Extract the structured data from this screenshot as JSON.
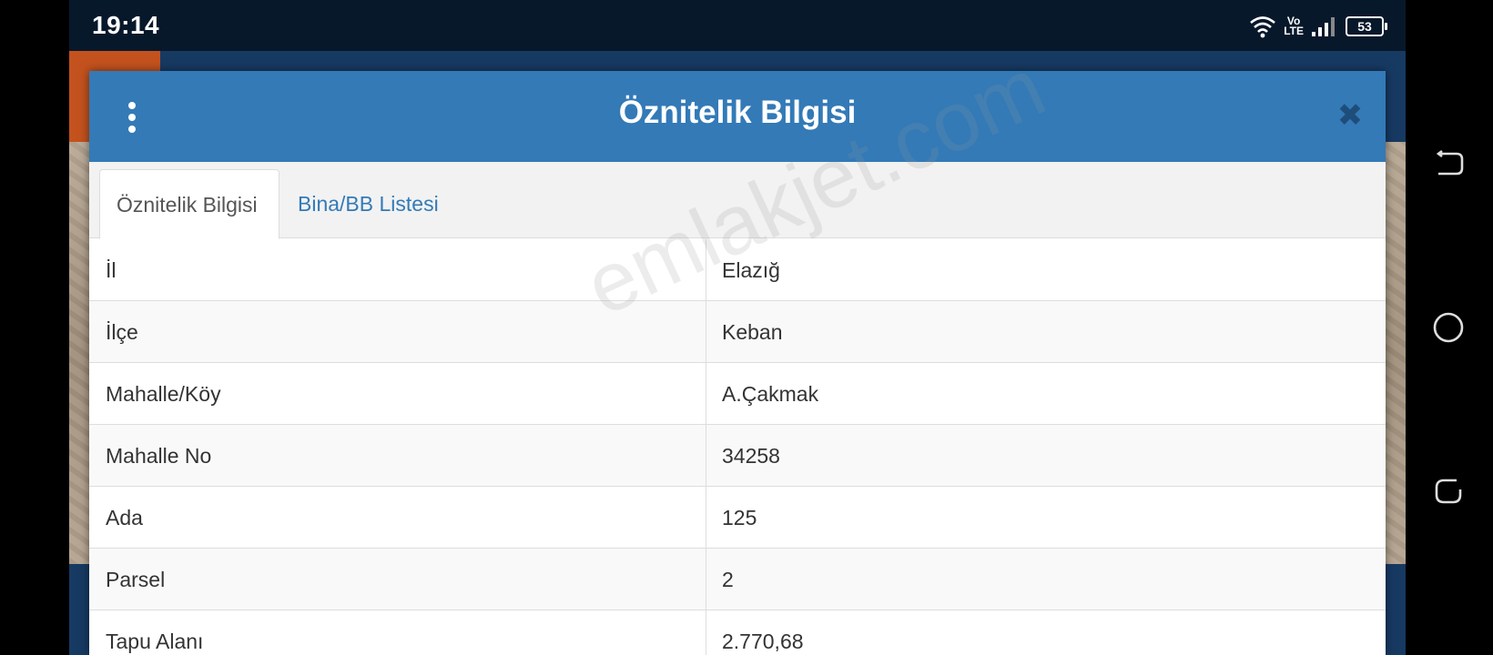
{
  "status_bar": {
    "time": "19:14",
    "volte_top": "Vo",
    "volte_bottom": "LTE",
    "battery": "53"
  },
  "modal": {
    "title": "Öznitelik Bilgisi",
    "menu_icon": "more-vertical-icon",
    "close_icon": "close-icon",
    "close_glyph": "✖"
  },
  "tabs": [
    {
      "label": "Öznitelik Bilgisi",
      "active": true
    },
    {
      "label": "Bina/BB Listesi",
      "active": false
    }
  ],
  "table": {
    "rows": [
      {
        "label": "İl",
        "value": "Elazığ"
      },
      {
        "label": "İlçe",
        "value": "Keban"
      },
      {
        "label": "Mahalle/Köy",
        "value": "A.Çakmak"
      },
      {
        "label": "Mahalle No",
        "value": "34258"
      },
      {
        "label": "Ada",
        "value": "125"
      },
      {
        "label": "Parsel",
        "value": "2"
      },
      {
        "label": "Tapu Alanı",
        "value": "2.770,68"
      }
    ]
  },
  "watermark": "emlakjet.com",
  "colors": {
    "header": "#337ab7",
    "link": "#337ab7",
    "close": "#1f4d7a"
  },
  "nav_bar": {
    "icons": [
      "back-icon",
      "home-icon",
      "recents-icon"
    ]
  }
}
